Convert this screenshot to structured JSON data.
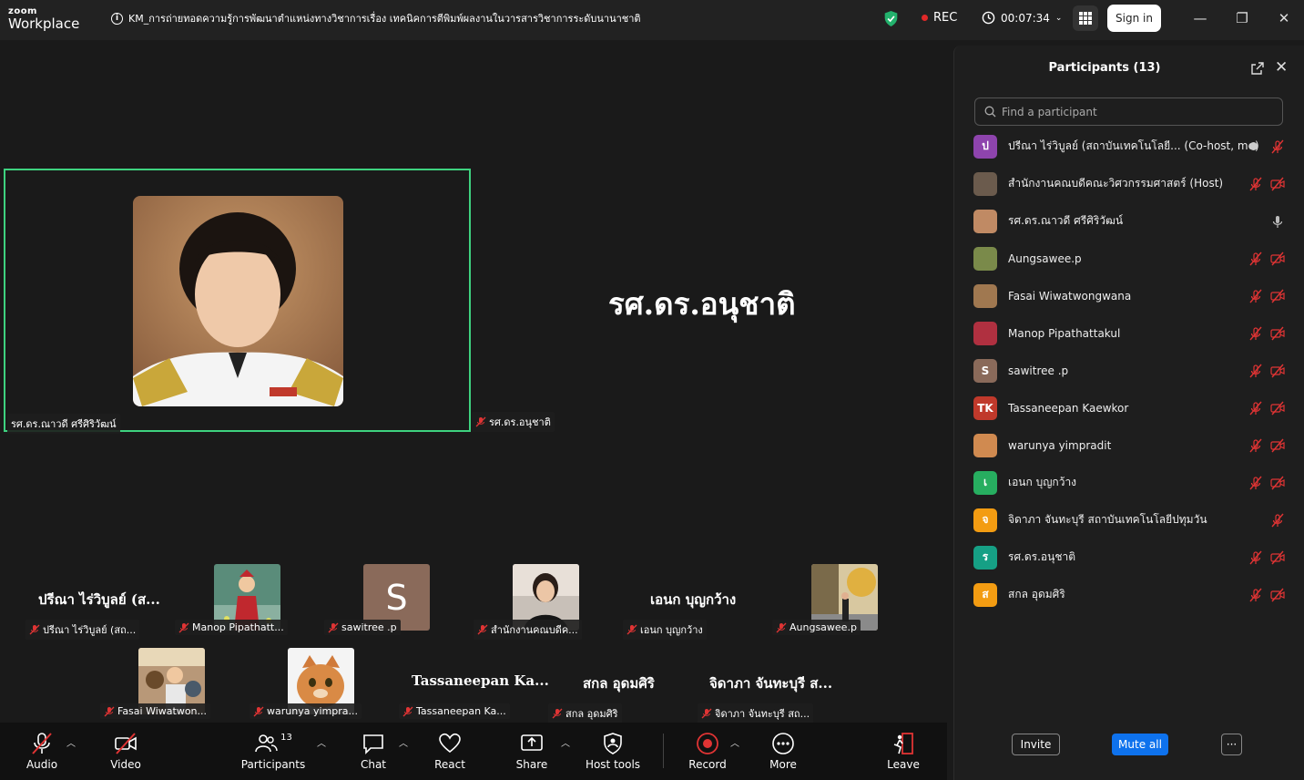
{
  "app": {
    "logo_top": "zoom",
    "logo_bottom": "Workplace"
  },
  "meeting": {
    "title": "KM_การถ่ายทอดความรู้การพัฒนาตำแหน่งทางวิชาการเรื่อง  เทคนิคการตีพิมพ์ผลงานในวารสารวิชาการระดับนานาชาติ",
    "rec_label": "REC",
    "timer": "00:07:34",
    "sign_in": "Sign in"
  },
  "stage": {
    "active_label": "รศ.ดร.ณาวดี ศรีศิริวัฒน์",
    "second_label": "รศ.ดร.อนุชาติ",
    "second_big": "รศ.ดร.อนุชาติ"
  },
  "gallery": {
    "row1": [
      {
        "big": "ปรีณา ไร่วิบูลย์ (ส...",
        "label": "ปรีณา ไร่วิบูลย์ (สถ..."
      },
      {
        "label": "Manop Pipathatt..."
      },
      {
        "letter": "S",
        "label": "sawitree .p"
      },
      {
        "label": "สำนักงานคณบดีค..."
      },
      {
        "big": "เอนก บุญกว้าง",
        "label": "เอนก บุญกว้าง"
      },
      {
        "label": "Aungsawee.p"
      }
    ],
    "row2": [
      {
        "label": "Fasai Wiwatwon..."
      },
      {
        "label": "warunya yimpra..."
      },
      {
        "big": "Tassaneepan Ka...",
        "label": "Tassaneepan Ka..."
      },
      {
        "big": "สกล อุดมศิริ",
        "label": "สกล อุดมศิริ"
      },
      {
        "big": "จิดาภา จันทะบุรี ส...",
        "label": "จิดาภา จันทะบุรี สถ..."
      }
    ]
  },
  "toolbar": {
    "audio": "Audio",
    "video": "Video",
    "participants": "Participants",
    "participants_count": "13",
    "chat": "Chat",
    "react": "React",
    "share": "Share",
    "host_tools": "Host tools",
    "record": "Record",
    "more": "More",
    "leave": "Leave"
  },
  "panel": {
    "title": "Participants (13)",
    "search_placeholder": "Find a participant",
    "invite": "Invite",
    "mute_all": "Mute all",
    "more": "···",
    "participants": [
      {
        "name": "ปรีณา ไร่วิบูลย์ (สถาบันเทคโนโลยี... (Co-host, me)",
        "avatar": "ป",
        "color": "#8e44ad",
        "mic": "muted",
        "video": "none",
        "extra_dot": true
      },
      {
        "name": "สำนักงานคณบดีคณะวิศวกรรมศาสตร์ (Host)",
        "avatar": "",
        "color": "#6b5b4d",
        "mic": "muted",
        "video": "off"
      },
      {
        "name": "รศ.ดร.ณาวดี ศรีศิริวัฒน์",
        "avatar": "",
        "color": "#c08a64",
        "mic": "on",
        "video": "none"
      },
      {
        "name": "Aungsawee.p",
        "avatar": "",
        "color": "#7a8a4a",
        "mic": "muted",
        "video": "off"
      },
      {
        "name": "Fasai Wiwatwongwana",
        "avatar": "",
        "color": "#a07850",
        "mic": "muted",
        "video": "off"
      },
      {
        "name": "Manop Pipathattakul",
        "avatar": "",
        "color": "#b03040",
        "mic": "muted",
        "video": "off"
      },
      {
        "name": "sawitree .p",
        "avatar": "S",
        "color": "#8a6a5a",
        "mic": "muted",
        "video": "off"
      },
      {
        "name": "Tassaneepan Kaewkor",
        "avatar": "TK",
        "color": "#c0392b",
        "mic": "muted",
        "video": "off"
      },
      {
        "name": "warunya yimpradit",
        "avatar": "",
        "color": "#d08a50",
        "mic": "muted",
        "video": "off"
      },
      {
        "name": "เอนก บุญกว้าง",
        "avatar": "เ",
        "color": "#27ae60",
        "mic": "muted",
        "video": "off"
      },
      {
        "name": "จิดาภา จันทะบุรี สถาบันเทคโนโลยีปทุมวัน",
        "avatar": "จ",
        "color": "#f39c12",
        "mic": "muted",
        "video": "none"
      },
      {
        "name": "รศ.ดร.อนุชาติ",
        "avatar": "ร",
        "color": "#16a085",
        "mic": "muted",
        "video": "off"
      },
      {
        "name": "สกล อุดมศิริ",
        "avatar": "ส",
        "color": "#f39c12",
        "mic": "muted",
        "video": "off"
      }
    ]
  },
  "colors": {
    "accent_green": "#3ed27f",
    "mute_red": "#e03434",
    "mute_all_blue": "#0e72ed"
  }
}
